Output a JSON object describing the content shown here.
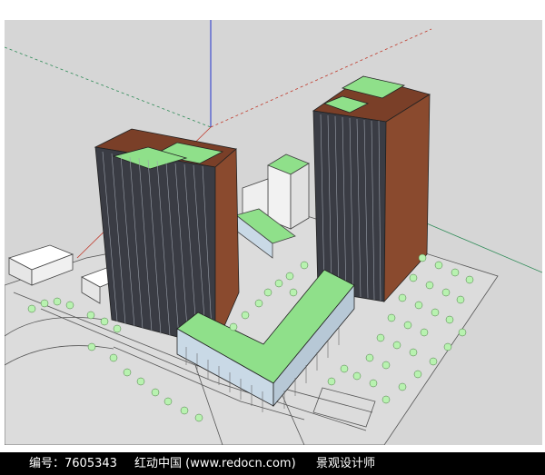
{
  "canvas": {
    "name": "SketchUp model viewport",
    "background": "#d6d6d6",
    "axes": {
      "red": "#c0392b",
      "green": "#2e8b57",
      "blue": "#2233cc"
    },
    "colors": {
      "roof_green": "#8fe08a",
      "wall_brown": "#8a4a2e",
      "glass_dark": "#3a3c44",
      "podium_base": "#c9d9e6",
      "white_block": "#f2f2f2",
      "tree": "#b8f2b0"
    }
  },
  "footer": {
    "id_text": "编号：7605343",
    "site_text": "红动中国 (www.redocn.com)",
    "title_text": "景观设计师"
  }
}
